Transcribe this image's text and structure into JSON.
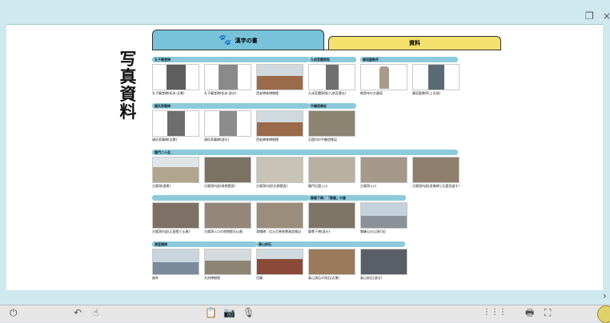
{
  "tabs": {
    "main": "漢字の書",
    "secondary": "資料"
  },
  "side_title": [
    "写",
    "真",
    "資",
    "料"
  ],
  "window": {
    "restore_icon": "restore-icon",
    "close_glyph": "×"
  },
  "sections": [
    {
      "label": "孔子廟堂碑",
      "id": "s1"
    },
    {
      "label": "九成宮醴泉銘",
      "id": "s2"
    },
    {
      "label": "雁塔聖教序",
      "id": "s3"
    },
    {
      "label": "顔氏家廟碑",
      "id": "s4"
    },
    {
      "label": "牛橛造像記",
      "id": "s5"
    },
    {
      "label": "龍門二十品",
      "id": "s6"
    },
    {
      "label": "",
      "id": "s7"
    },
    {
      "label": "鄭羲下碑／「鄭羲」の書",
      "id": "s8"
    },
    {
      "label": "張猛龍碑",
      "id": "s9"
    },
    {
      "label": "泰山刻石",
      "id": "s10"
    }
  ],
  "photos": [
    {
      "caption": "孔子廟堂碑(拓本·全景)",
      "color": "#6b6b6b"
    },
    {
      "caption": "孔子廟堂碑(拓本·部分)",
      "color": "#8a8a8a"
    },
    {
      "caption": "西安碑林博物館",
      "color": "#9a6a4a"
    },
    {
      "caption": "九成宮醴泉銘(九成宮遺址)",
      "color": "#707070"
    },
    {
      "caption": "慈恩寺の大雁塔",
      "color": "#a89b88"
    },
    {
      "caption": "雁塔聖教序(上半部)",
      "color": "#5a6a74"
    },
    {
      "caption": "顔氏家廟碑(全景)",
      "color": "#6e6e6e"
    },
    {
      "caption": "顔氏家廟碑(部分)",
      "color": "#8c8c8c"
    },
    {
      "caption": "西安碑林博物館",
      "color": "#9a6a4a"
    },
    {
      "caption": "石窟内の牛橛造像記",
      "color": "#8a8470"
    },
    {
      "caption": "古陽洞(遠景)",
      "color": "#b0a690"
    },
    {
      "caption": "古陽洞内部(南側壁面)",
      "color": "#7c7264"
    },
    {
      "caption": "古陽洞内部(北側壁面)",
      "color": "#c9c2b6"
    },
    {
      "caption": "龍門石窟入口",
      "color": "#b9b0a2"
    },
    {
      "caption": "古陽洞入口",
      "color": "#a6998a"
    },
    {
      "caption": "古陽洞内部(造像碑と石窟見渡す)",
      "color": "#8e7e6c"
    },
    {
      "caption": "古陽洞内部(正面壁と仏像)",
      "color": "#7d7064"
    },
    {
      "caption": "古陽洞入口の南側壁石仏像",
      "color": "#94877a"
    },
    {
      "caption": "滑稽碑／比丘尼慈香慧政造像記",
      "color": "#9b8d7c"
    },
    {
      "caption": "鄭羲下碑(部分)",
      "color": "#7e7466"
    },
    {
      "caption": "雲峰山の山頂付近",
      "color": "#8c9098"
    },
    {
      "caption": "曲阜",
      "color": "#7a8a9a"
    },
    {
      "caption": "孔府博物館",
      "color": "#8e8474"
    },
    {
      "caption": "岱廟",
      "color": "#8a4a3a"
    },
    {
      "caption": "泰山頂石の残石(近景)",
      "color": "#9a7a5a"
    },
    {
      "caption": "泰山刻石(部分)",
      "color": "#5a5e66"
    }
  ],
  "taskbar": {
    "power_icon": "power-icon",
    "undo_icon": "undo-icon",
    "pointer_icon": "pointer-icon",
    "clipboard_icon": "clipboard-icon",
    "camera_icon": "camera-icon",
    "mic_icon": "microphone-icon",
    "grid_icon": "grid-icon",
    "print_icon": "print-icon",
    "fullscreen_icon": "fullscreen-icon"
  },
  "colors": {
    "frame": "#cfe9ef",
    "tab_main": "#78c3d9",
    "tab_secondary": "#f4e06c",
    "section_bar": "#8ccadb"
  }
}
